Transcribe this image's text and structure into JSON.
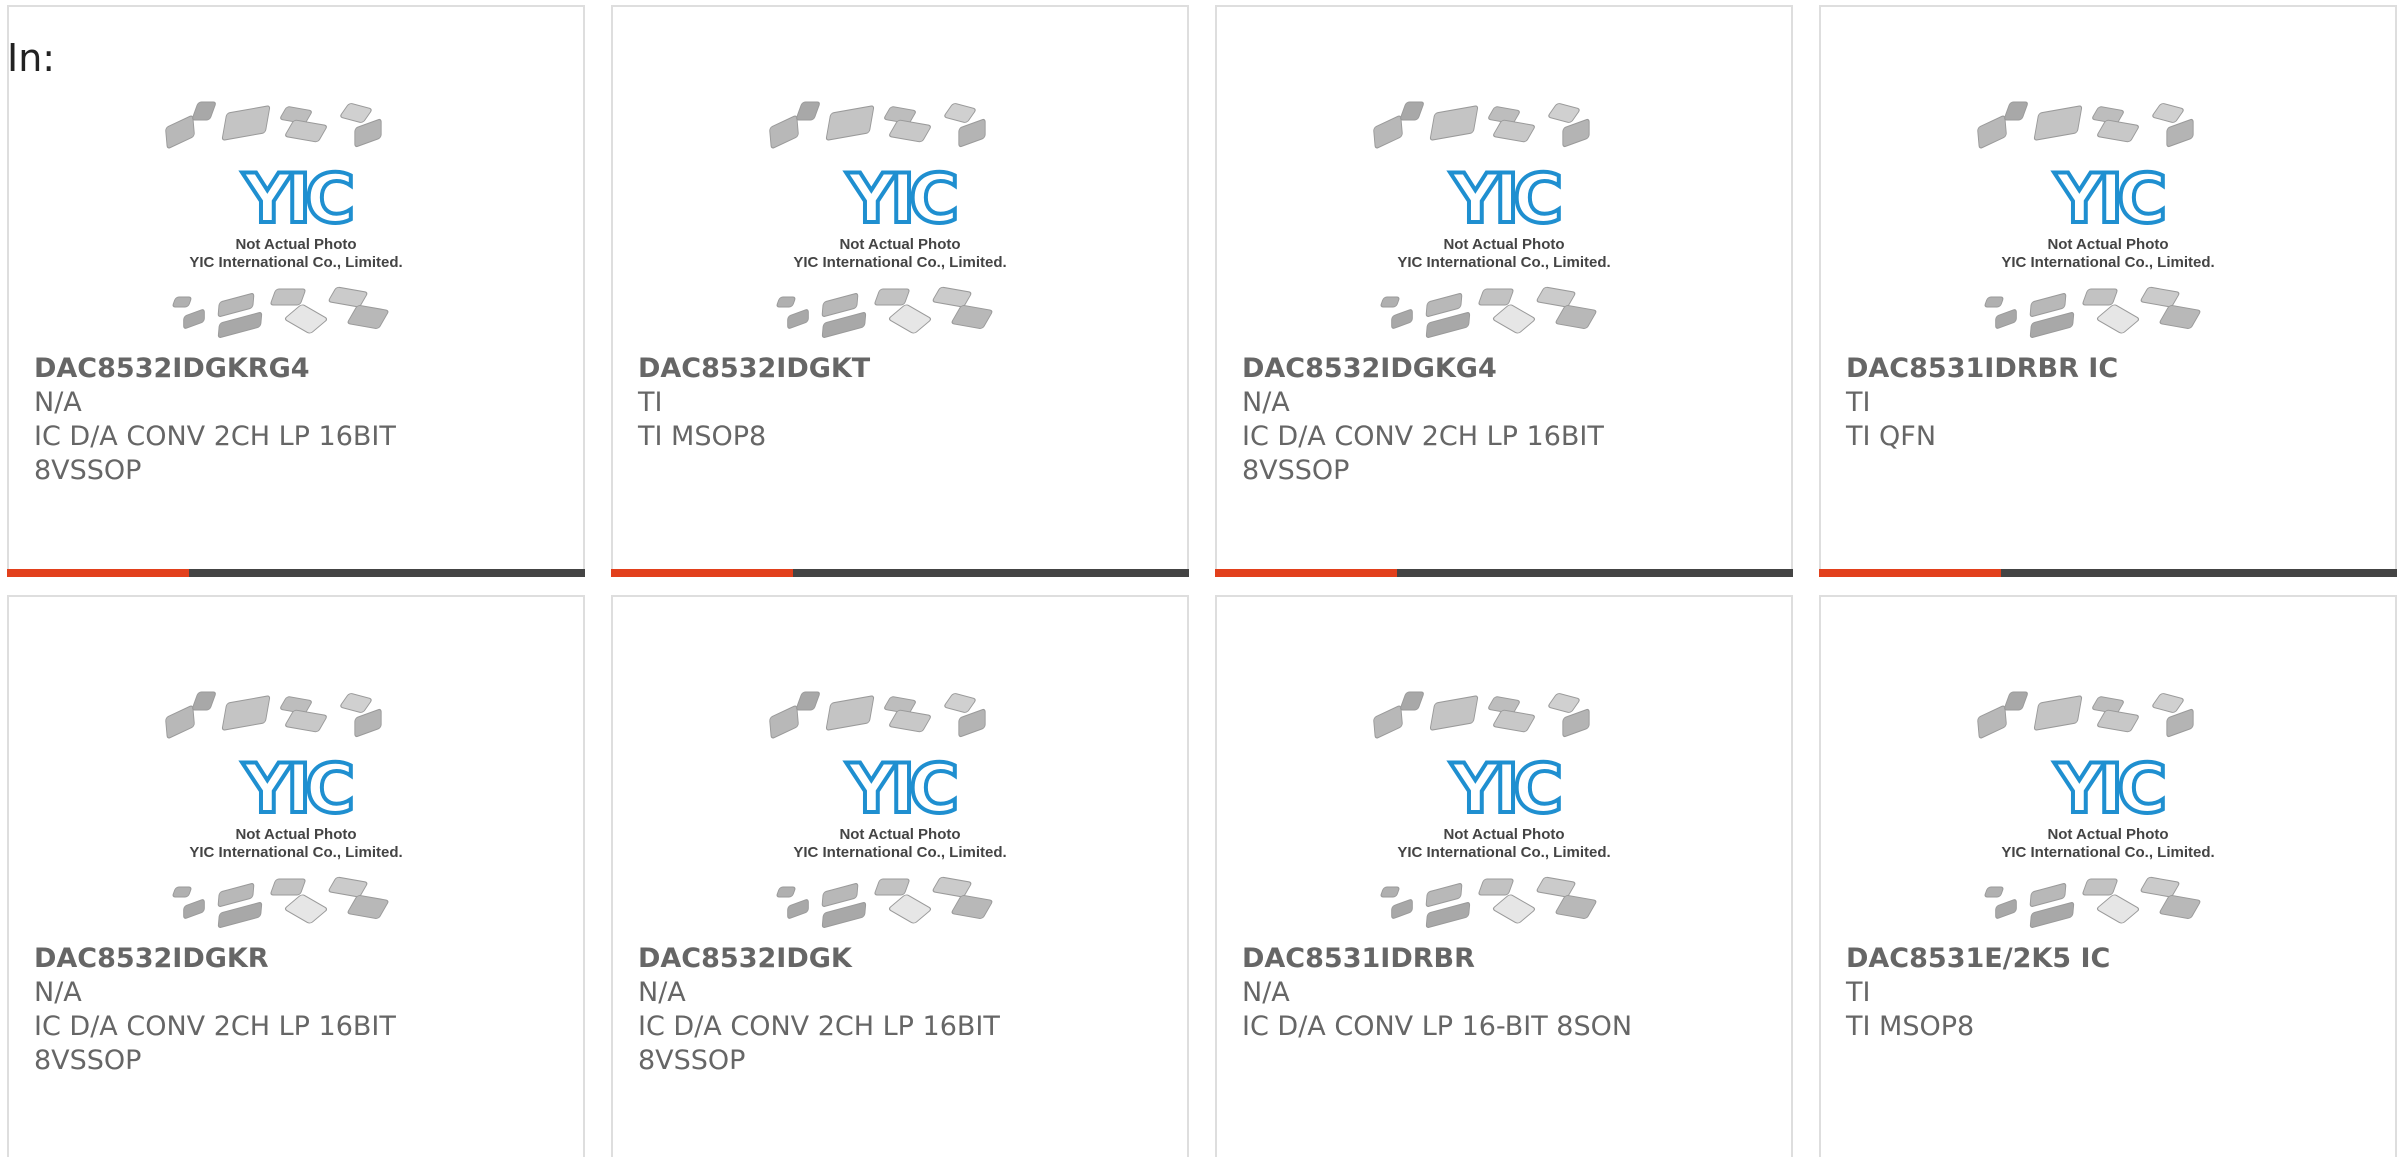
{
  "header": {
    "label": "In:"
  },
  "colors": {
    "accent": "#e2401c",
    "bar": "#444444",
    "border": "#dedede",
    "text": "#666666",
    "logo": "#1f8fd0"
  },
  "placeholder": {
    "line1": "Not Actual Photo",
    "line2": "YIC International Co., Limited.",
    "logo_text": "YIC"
  },
  "products": [
    {
      "part": "DAC8532IDGKRG4",
      "maker": "N/A",
      "desc_line1": "IC D/A CONV 2CH LP 16BIT",
      "desc_line2": "8VSSOP"
    },
    {
      "part": "DAC8532IDGKT",
      "maker": "TI",
      "desc_line1": "TI MSOP8",
      "desc_line2": ""
    },
    {
      "part": "DAC8532IDGKG4",
      "maker": "N/A",
      "desc_line1": "IC D/A CONV 2CH LP 16BIT",
      "desc_line2": "8VSSOP"
    },
    {
      "part": "DAC8531IDRBR IC",
      "maker": "TI",
      "desc_line1": "TI QFN",
      "desc_line2": ""
    },
    {
      "part": "DAC8532IDGKR",
      "maker": "N/A",
      "desc_line1": "IC D/A CONV 2CH LP 16BIT",
      "desc_line2": "8VSSOP"
    },
    {
      "part": "DAC8532IDGK",
      "maker": "N/A",
      "desc_line1": "IC D/A CONV 2CH LP 16BIT",
      "desc_line2": "8VSSOP"
    },
    {
      "part": "DAC8531IDRBR",
      "maker": "N/A",
      "desc_line1": "IC D/A CONV LP 16-BIT 8SON",
      "desc_line2": ""
    },
    {
      "part": "DAC8531E/2K5 IC",
      "maker": "TI",
      "desc_line1": "TI MSOP8",
      "desc_line2": ""
    }
  ]
}
